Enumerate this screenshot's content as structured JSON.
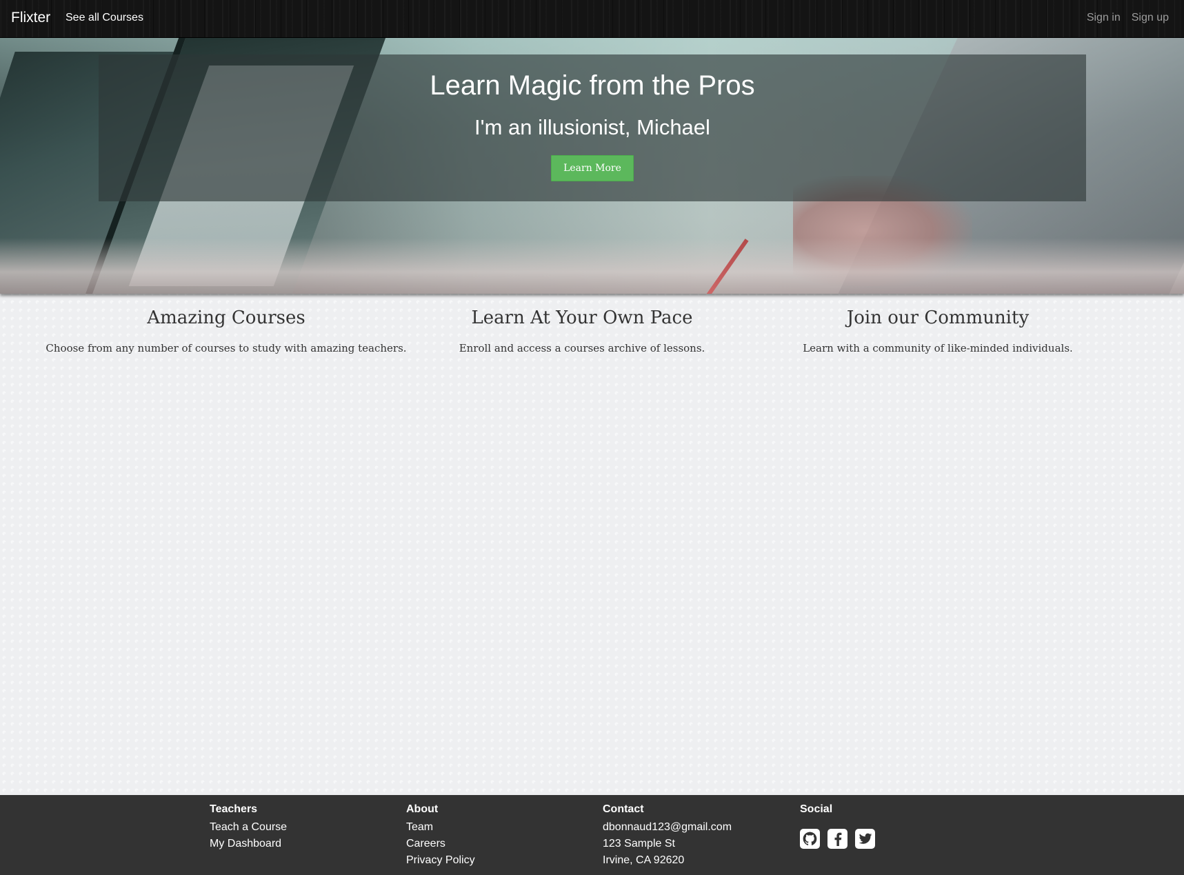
{
  "navbar": {
    "brand": "Flixter",
    "see_all_courses": "See all Courses",
    "sign_in": "Sign in",
    "sign_up": "Sign up"
  },
  "hero": {
    "title": "Learn Magic from the Pros",
    "subtitle": "I'm an illusionist, Michael",
    "button_label": "Learn More",
    "button_color": "#5cb85c"
  },
  "features": [
    {
      "heading": "Amazing Courses",
      "text": "Choose from any number of courses to study with amazing teachers."
    },
    {
      "heading": "Learn At Your Own Pace",
      "text": "Enroll and access a courses archive of lessons."
    },
    {
      "heading": "Join our Community",
      "text": "Learn with a community of like-minded individuals."
    }
  ],
  "footer": {
    "teachers": {
      "heading": "Teachers",
      "links": [
        "Teach a Course",
        "My Dashboard"
      ]
    },
    "about": {
      "heading": "About",
      "links": [
        "Team",
        "Careers",
        "Privacy Policy"
      ]
    },
    "contact": {
      "heading": "Contact",
      "lines": [
        "dbonnaud123@gmail.com",
        "123 Sample St",
        "Irvine, CA 92620"
      ]
    },
    "social": {
      "heading": "Social",
      "icons": [
        "github-icon",
        "facebook-icon",
        "twitter-icon"
      ]
    }
  }
}
